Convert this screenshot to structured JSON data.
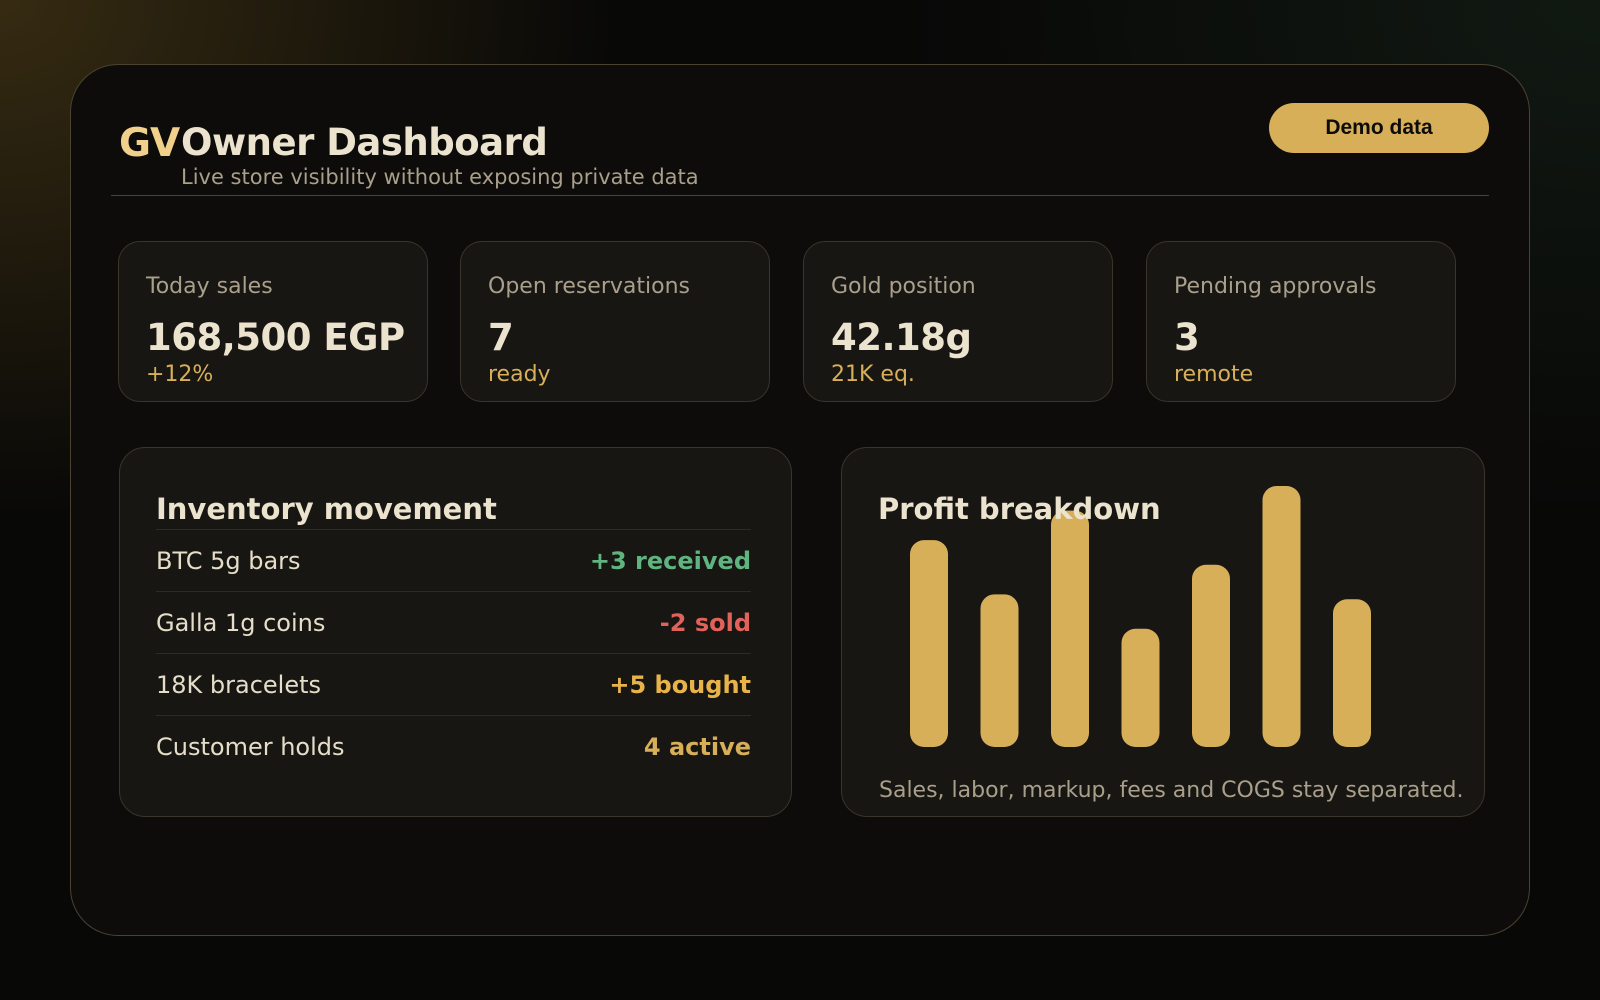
{
  "header": {
    "logo": "GV",
    "title": "Owner Dashboard",
    "subtitle": "Live store visibility without exposing private data",
    "demo_label": "Demo data"
  },
  "kpis": [
    {
      "label": "Today sales",
      "value": "168,500 EGP",
      "sub": "+12%"
    },
    {
      "label": "Open reservations",
      "value": "7",
      "sub": "ready"
    },
    {
      "label": "Gold position",
      "value": "42.18g",
      "sub": "21K eq."
    },
    {
      "label": "Pending approvals",
      "value": "3",
      "sub": "remote"
    }
  ],
  "inventory": {
    "title": "Inventory movement",
    "rows": [
      {
        "name": "BTC 5g bars",
        "value": "+3 received",
        "status": "positive"
      },
      {
        "name": "Galla 1g coins",
        "value": "-2 sold",
        "status": "negative"
      },
      {
        "name": "18K bracelets",
        "value": "+5 bought",
        "status": "gold"
      },
      {
        "name": "Customer holds",
        "value": "4 active",
        "status": "neutral"
      }
    ]
  },
  "profit": {
    "title": "Profit breakdown",
    "note": "Sales, labor, markup, fees and COGS stay separated."
  },
  "colors": {
    "accent": "#d8af59",
    "positive": "#5fb47f",
    "negative": "#e0625a",
    "gold": "#e8b44a",
    "background": "#0d0c0a",
    "card": "#171613"
  },
  "chart_data": {
    "type": "bar",
    "title": "Profit breakdown",
    "categories": [],
    "values": [
      210,
      155,
      240,
      120,
      185,
      265,
      150
    ],
    "ylim": [
      0,
      265
    ],
    "grid": false,
    "color": "#d8af59"
  }
}
